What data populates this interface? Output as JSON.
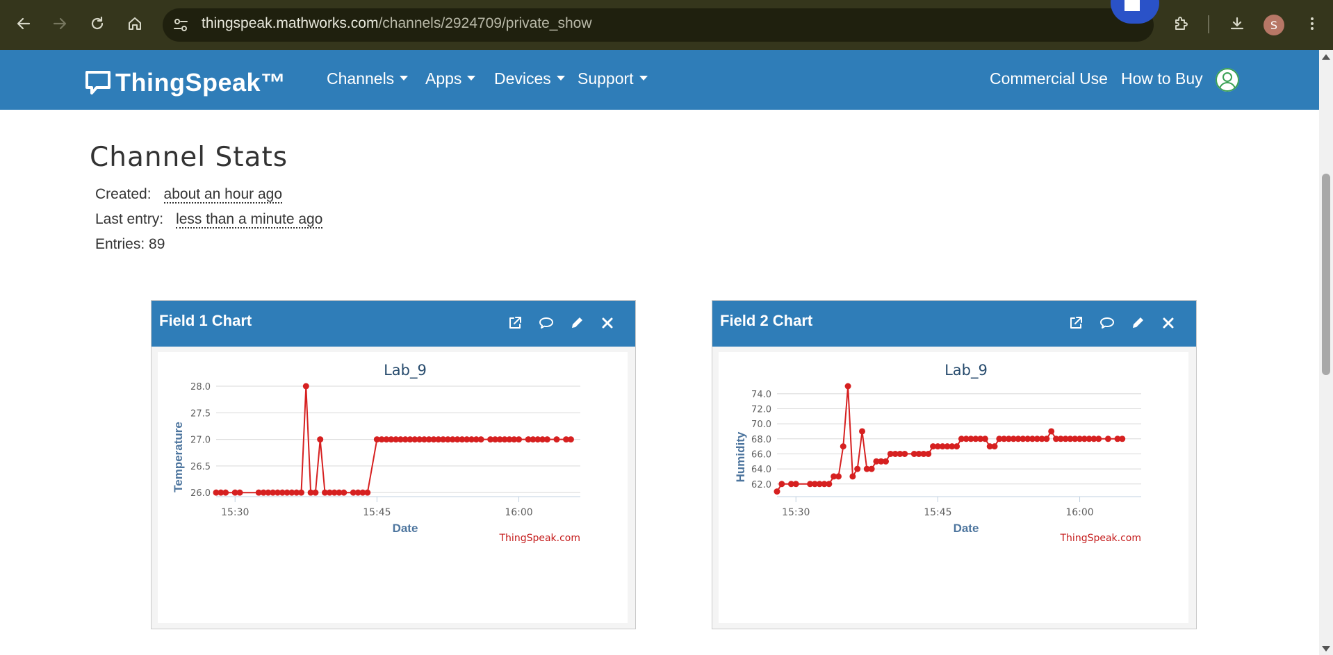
{
  "browser": {
    "url_host": "thingspeak.mathworks.com",
    "url_path": "/channels/2924709/private_show",
    "profile_initial": "S"
  },
  "nav": {
    "logo": "ThingSpeak™",
    "menus": [
      "Channels",
      "Apps",
      "Devices",
      "Support"
    ],
    "commercial": "Commercial Use",
    "how_to_buy": "How to Buy"
  },
  "stats": {
    "title": "Channel Stats",
    "created_label": "Created:",
    "created_value": "about an hour ago",
    "last_entry_label": "Last entry:",
    "last_entry_value": "less than a minute ago",
    "entries": "Entries: 89"
  },
  "panels": [
    {
      "title": "Field 1 Chart"
    },
    {
      "title": "Field 2 Chart"
    }
  ],
  "chart_data": [
    {
      "type": "line",
      "title": "Lab_9",
      "xlabel": "Date",
      "ylabel": "Temperature",
      "credit": "ThingSpeak.com",
      "color": "#d62020",
      "x_ticks": [
        "15:30",
        "15:45",
        "16:00"
      ],
      "y_ticks": [
        "26.0",
        "26.5",
        "27.0",
        "27.5",
        "28.0"
      ],
      "xlim": [
        "15:28:00",
        "16:06:30"
      ],
      "ylim": [
        25.95,
        28.0
      ],
      "x": [
        "15:28:00",
        "15:28:30",
        "15:29:00",
        "15:30:00",
        "15:30:30",
        "15:32:30",
        "15:33:00",
        "15:33:30",
        "15:34:00",
        "15:34:30",
        "15:35:00",
        "15:35:30",
        "15:36:00",
        "15:36:30",
        "15:37:00",
        "15:37:30",
        "15:38:00",
        "15:38:30",
        "15:39:00",
        "15:39:30",
        "15:40:00",
        "15:40:30",
        "15:41:00",
        "15:41:30",
        "15:42:30",
        "15:43:00",
        "15:43:30",
        "15:44:00",
        "15:45:00",
        "15:45:30",
        "15:46:00",
        "15:46:30",
        "15:47:00",
        "15:47:30",
        "15:48:00",
        "15:48:30",
        "15:49:00",
        "15:49:30",
        "15:50:00",
        "15:50:30",
        "15:51:00",
        "15:51:30",
        "15:52:00",
        "15:52:30",
        "15:53:00",
        "15:53:30",
        "15:54:00",
        "15:54:30",
        "15:55:00",
        "15:55:30",
        "15:56:00",
        "15:57:00",
        "15:57:30",
        "15:58:00",
        "15:58:30",
        "15:59:00",
        "15:59:30",
        "16:00:00",
        "16:01:00",
        "16:01:30",
        "16:02:00",
        "16:02:30",
        "16:03:00",
        "16:04:00",
        "16:05:00",
        "16:05:30"
      ],
      "y": [
        26.0,
        26.0,
        26.0,
        26.0,
        26.0,
        26.0,
        26.0,
        26.0,
        26.0,
        26.0,
        26.0,
        26.0,
        26.0,
        26.0,
        26.0,
        28.0,
        26.0,
        26.0,
        27.0,
        26.0,
        26.0,
        26.0,
        26.0,
        26.0,
        26.0,
        26.0,
        26.0,
        26.0,
        27.0,
        27.0,
        27.0,
        27.0,
        27.0,
        27.0,
        27.0,
        27.0,
        27.0,
        27.0,
        27.0,
        27.0,
        27.0,
        27.0,
        27.0,
        27.0,
        27.0,
        27.0,
        27.0,
        27.0,
        27.0,
        27.0,
        27.0,
        27.0,
        27.0,
        27.0,
        27.0,
        27.0,
        27.0,
        27.0,
        27.0,
        27.0,
        27.0,
        27.0,
        27.0,
        27.0,
        27.0,
        27.0
      ]
    },
    {
      "type": "line",
      "title": "Lab_9",
      "xlabel": "Date",
      "ylabel": "Humidity",
      "credit": "ThingSpeak.com",
      "color": "#d62020",
      "x_ticks": [
        "15:30",
        "15:45",
        "16:00"
      ],
      "y_ticks": [
        "62.0",
        "64.0",
        "66.0",
        "68.0",
        "70.0",
        "72.0",
        "74.0"
      ],
      "xlim": [
        "15:28:00",
        "16:06:30"
      ],
      "ylim": [
        60.5,
        75.0
      ],
      "x": [
        "15:28:00",
        "15:28:30",
        "15:29:30",
        "15:30:00",
        "15:31:30",
        "15:32:00",
        "15:32:30",
        "15:33:00",
        "15:33:30",
        "15:34:00",
        "15:34:30",
        "15:35:00",
        "15:35:30",
        "15:36:00",
        "15:36:30",
        "15:37:00",
        "15:37:30",
        "15:38:00",
        "15:38:30",
        "15:39:00",
        "15:39:30",
        "15:40:00",
        "15:40:30",
        "15:41:00",
        "15:41:30",
        "15:42:30",
        "15:43:00",
        "15:43:30",
        "15:44:00",
        "15:44:30",
        "15:45:00",
        "15:45:30",
        "15:46:00",
        "15:46:30",
        "15:47:00",
        "15:47:30",
        "15:48:00",
        "15:48:30",
        "15:49:00",
        "15:49:30",
        "15:50:00",
        "15:50:30",
        "15:51:00",
        "15:51:30",
        "15:52:00",
        "15:52:30",
        "15:53:00",
        "15:53:30",
        "15:54:00",
        "15:54:30",
        "15:55:00",
        "15:55:30",
        "15:56:00",
        "15:56:30",
        "15:57:00",
        "15:57:30",
        "15:58:00",
        "15:58:30",
        "15:59:00",
        "15:59:30",
        "16:00:00",
        "16:00:30",
        "16:01:00",
        "16:01:30",
        "16:02:00",
        "16:03:00",
        "16:04:00",
        "16:04:30"
      ],
      "y": [
        61,
        62,
        62,
        62,
        62,
        62,
        62,
        62,
        62,
        63,
        63,
        67,
        75,
        63,
        64,
        69,
        64,
        64,
        65,
        65,
        65,
        66,
        66,
        66,
        66,
        66,
        66,
        66,
        66,
        67,
        67,
        67,
        67,
        67,
        67,
        68,
        68,
        68,
        68,
        68,
        68,
        67,
        67,
        68,
        68,
        68,
        68,
        68,
        68,
        68,
        68,
        68,
        68,
        68,
        69,
        68,
        68,
        68,
        68,
        68,
        68,
        68,
        68,
        68,
        68,
        68,
        68,
        68
      ]
    }
  ]
}
